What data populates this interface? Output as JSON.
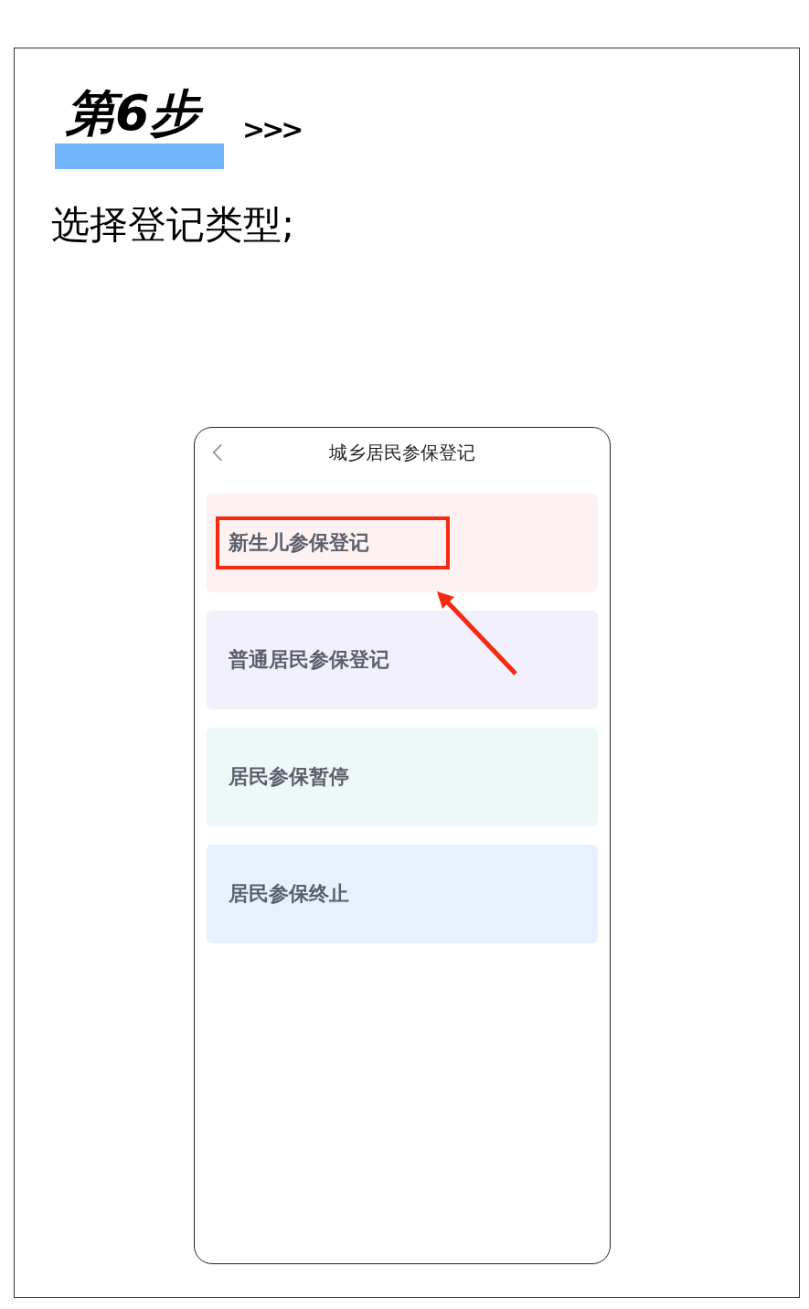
{
  "step": {
    "title": "第6步",
    "chevrons": ">>>"
  },
  "instruction": "选择登记类型;",
  "phone": {
    "title": "城乡居民参保登记",
    "options": [
      {
        "label": "新生儿参保登记",
        "color": "#fdf1f1",
        "highlighted": true
      },
      {
        "label": "普通居民参保登记",
        "color": "#f1f0fc",
        "highlighted": false
      },
      {
        "label": "居民参保暂停",
        "color": "#edf8f8",
        "highlighted": false
      },
      {
        "label": "居民参保终止",
        "color": "#e6f1fd",
        "highlighted": false
      }
    ]
  }
}
